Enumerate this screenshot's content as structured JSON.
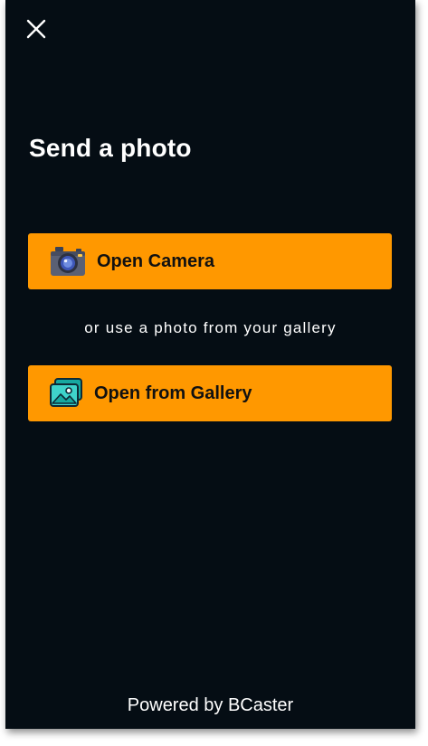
{
  "page": {
    "title": "Send a photo",
    "close_icon": "close-icon"
  },
  "actions": {
    "camera": {
      "label": "Open Camera",
      "icon": "camera-icon"
    },
    "separator": "or use a photo from your gallery",
    "gallery": {
      "label": "Open from Gallery",
      "icon": "gallery-icon"
    }
  },
  "footer": {
    "powered_by": "Powered by BCaster"
  },
  "colors": {
    "background": "#050d14",
    "accent": "#ff9800",
    "text_light": "#ffffff",
    "text_dark": "#111111"
  }
}
